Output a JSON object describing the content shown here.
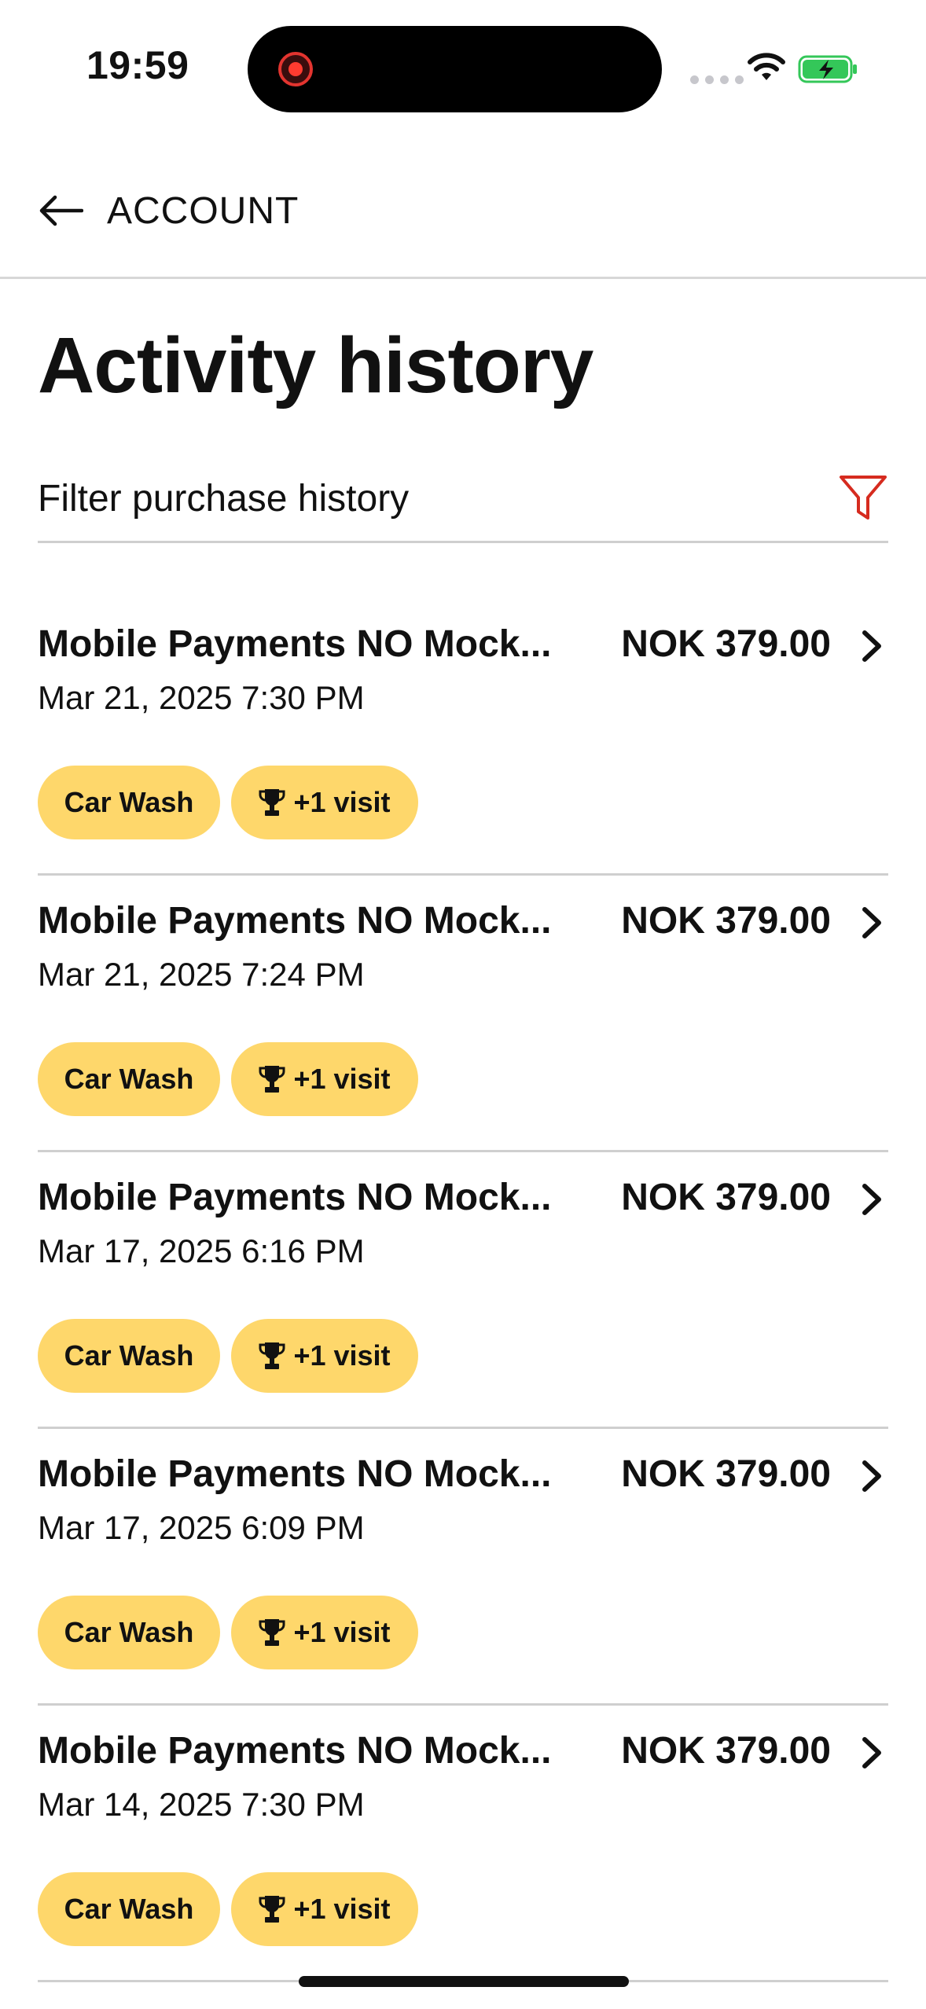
{
  "status_bar": {
    "time": "19:59",
    "icons": [
      "screen-recording-icon",
      "signal-icon",
      "wifi-icon",
      "battery-charging-icon"
    ],
    "battery_color": "#34c759",
    "recording_color": "#ff3b30"
  },
  "header": {
    "back_icon": "arrow-left-icon",
    "back_label": "ACCOUNT"
  },
  "page": {
    "title": "Activity history"
  },
  "filter": {
    "label": "Filter purchase history",
    "icon": "funnel-icon",
    "icon_color": "#d62b1f"
  },
  "activities": [
    {
      "merchant": "Mobile Payments NO Mock...",
      "amount": "NOK 379.00",
      "date": "Mar 21, 2025 7:30 PM",
      "category": "Car Wash",
      "visit": "+1 visit"
    },
    {
      "merchant": "Mobile Payments NO Mock...",
      "amount": "NOK 379.00",
      "date": "Mar 21, 2025 7:24 PM",
      "category": "Car Wash",
      "visit": "+1 visit"
    },
    {
      "merchant": "Mobile Payments NO Mock...",
      "amount": "NOK 379.00",
      "date": "Mar 17, 2025 6:16 PM",
      "category": "Car Wash",
      "visit": "+1 visit"
    },
    {
      "merchant": "Mobile Payments NO Mock...",
      "amount": "NOK 379.00",
      "date": "Mar 17, 2025 6:09 PM",
      "category": "Car Wash",
      "visit": "+1 visit"
    },
    {
      "merchant": "Mobile Payments NO Mock...",
      "amount": "NOK 379.00",
      "date": "Mar 14, 2025 7:30 PM",
      "category": "Car Wash",
      "visit": "+1 visit"
    }
  ],
  "colors": {
    "tag_background": "#fed76b",
    "divider": "#cfcfcf",
    "text": "#111111"
  }
}
